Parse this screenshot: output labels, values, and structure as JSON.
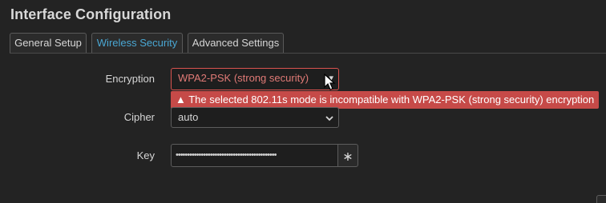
{
  "page": {
    "title": "Interface Configuration"
  },
  "tabs": [
    {
      "label": "General Setup",
      "active": false
    },
    {
      "label": "Wireless Security",
      "active": true
    },
    {
      "label": "Advanced Settings",
      "active": false
    }
  ],
  "form": {
    "encryption": {
      "label": "Encryption",
      "value": "WPA2-PSK (strong security)",
      "error": "▲ The selected 802.11s mode is incompatible with WPA2-PSK (strong security) encryption"
    },
    "cipher": {
      "label": "Cipher",
      "value": "auto"
    },
    "key": {
      "label": "Key",
      "masked_value": "••••••••••••••••••••••••••••••••••••••••••••",
      "reveal_symbol": "∗"
    }
  },
  "icons": {
    "select_chevron": "chevron-down-icon",
    "reveal": "asterisk-icon",
    "cursor": "mouse-pointer-icon"
  },
  "colors": {
    "background": "#232323",
    "active_tab": "#4aa7d3",
    "error": "#c64a48",
    "error_text": "#e07a76"
  }
}
